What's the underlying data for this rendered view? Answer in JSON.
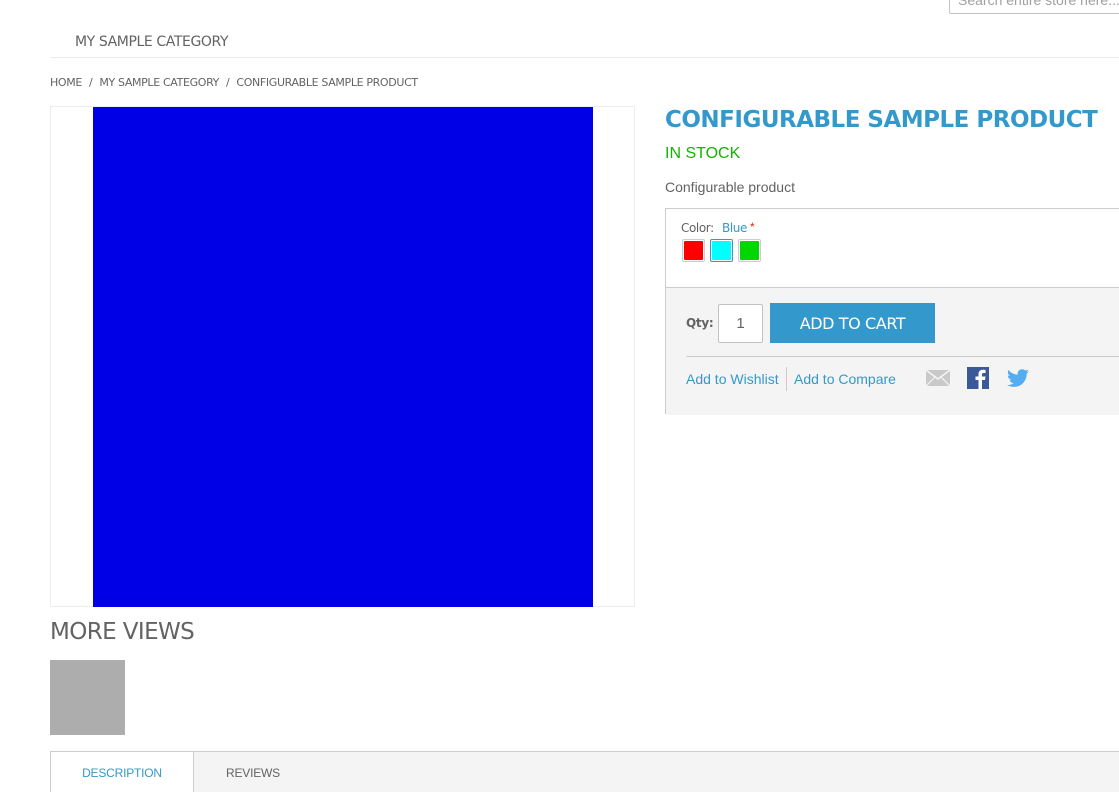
{
  "header": {
    "search_placeholder": "Search entire store here..."
  },
  "nav": {
    "items": [
      {
        "label": "MY SAMPLE CATEGORY"
      }
    ]
  },
  "breadcrumbs": {
    "items": [
      {
        "label": "HOME"
      },
      {
        "label": "MY SAMPLE CATEGORY"
      },
      {
        "label": "CONFIGURABLE SAMPLE PRODUCT"
      }
    ],
    "separator": "/"
  },
  "product": {
    "name": "CONFIGURABLE SAMPLE PRODUCT",
    "availability": "IN STOCK",
    "short_description": "Configurable product",
    "main_image_color": "#0000e6",
    "options": {
      "color_label": "Color:",
      "selected_value": "Blue",
      "required_mark": "*",
      "swatches": [
        {
          "name": "Red",
          "color": "#ff0000",
          "selected": false
        },
        {
          "name": "Blue",
          "color": "#00ffff",
          "selected": true
        },
        {
          "name": "Green",
          "color": "#00d600",
          "selected": false
        }
      ]
    },
    "qty_label": "Qty:",
    "qty_value": "1",
    "add_to_cart_label": "ADD TO CART",
    "links": {
      "wishlist": "Add to Wishlist",
      "compare": "Add to Compare"
    },
    "social": [
      "email-icon",
      "facebook-icon",
      "twitter-icon"
    ]
  },
  "more_views": {
    "title": "MORE VIEWS",
    "thumbnails": [
      {
        "color": "#adadad"
      }
    ]
  },
  "tabs": [
    {
      "label": "DESCRIPTION",
      "active": true
    },
    {
      "label": "REVIEWS",
      "active": false
    }
  ],
  "colors": {
    "accent": "#3399cc",
    "in_stock": "#11b400",
    "text": "#636363"
  }
}
